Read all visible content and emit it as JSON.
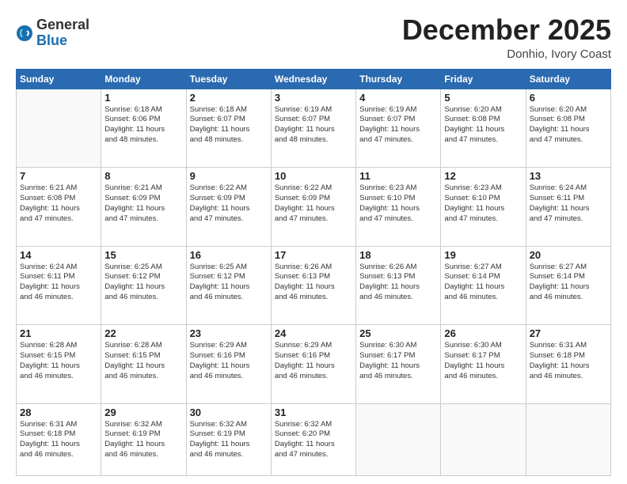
{
  "header": {
    "logo_general": "General",
    "logo_blue": "Blue",
    "month": "December 2025",
    "location": "Donhio, Ivory Coast"
  },
  "weekdays": [
    "Sunday",
    "Monday",
    "Tuesday",
    "Wednesday",
    "Thursday",
    "Friday",
    "Saturday"
  ],
  "weeks": [
    [
      {
        "day": "",
        "info": ""
      },
      {
        "day": "1",
        "info": "Sunrise: 6:18 AM\nSunset: 6:06 PM\nDaylight: 11 hours\nand 48 minutes."
      },
      {
        "day": "2",
        "info": "Sunrise: 6:18 AM\nSunset: 6:07 PM\nDaylight: 11 hours\nand 48 minutes."
      },
      {
        "day": "3",
        "info": "Sunrise: 6:19 AM\nSunset: 6:07 PM\nDaylight: 11 hours\nand 48 minutes."
      },
      {
        "day": "4",
        "info": "Sunrise: 6:19 AM\nSunset: 6:07 PM\nDaylight: 11 hours\nand 47 minutes."
      },
      {
        "day": "5",
        "info": "Sunrise: 6:20 AM\nSunset: 6:08 PM\nDaylight: 11 hours\nand 47 minutes."
      },
      {
        "day": "6",
        "info": "Sunrise: 6:20 AM\nSunset: 6:08 PM\nDaylight: 11 hours\nand 47 minutes."
      }
    ],
    [
      {
        "day": "7",
        "info": "Sunrise: 6:21 AM\nSunset: 6:08 PM\nDaylight: 11 hours\nand 47 minutes."
      },
      {
        "day": "8",
        "info": "Sunrise: 6:21 AM\nSunset: 6:09 PM\nDaylight: 11 hours\nand 47 minutes."
      },
      {
        "day": "9",
        "info": "Sunrise: 6:22 AM\nSunset: 6:09 PM\nDaylight: 11 hours\nand 47 minutes."
      },
      {
        "day": "10",
        "info": "Sunrise: 6:22 AM\nSunset: 6:09 PM\nDaylight: 11 hours\nand 47 minutes."
      },
      {
        "day": "11",
        "info": "Sunrise: 6:23 AM\nSunset: 6:10 PM\nDaylight: 11 hours\nand 47 minutes."
      },
      {
        "day": "12",
        "info": "Sunrise: 6:23 AM\nSunset: 6:10 PM\nDaylight: 11 hours\nand 47 minutes."
      },
      {
        "day": "13",
        "info": "Sunrise: 6:24 AM\nSunset: 6:11 PM\nDaylight: 11 hours\nand 47 minutes."
      }
    ],
    [
      {
        "day": "14",
        "info": "Sunrise: 6:24 AM\nSunset: 6:11 PM\nDaylight: 11 hours\nand 46 minutes."
      },
      {
        "day": "15",
        "info": "Sunrise: 6:25 AM\nSunset: 6:12 PM\nDaylight: 11 hours\nand 46 minutes."
      },
      {
        "day": "16",
        "info": "Sunrise: 6:25 AM\nSunset: 6:12 PM\nDaylight: 11 hours\nand 46 minutes."
      },
      {
        "day": "17",
        "info": "Sunrise: 6:26 AM\nSunset: 6:13 PM\nDaylight: 11 hours\nand 46 minutes."
      },
      {
        "day": "18",
        "info": "Sunrise: 6:26 AM\nSunset: 6:13 PM\nDaylight: 11 hours\nand 46 minutes."
      },
      {
        "day": "19",
        "info": "Sunrise: 6:27 AM\nSunset: 6:14 PM\nDaylight: 11 hours\nand 46 minutes."
      },
      {
        "day": "20",
        "info": "Sunrise: 6:27 AM\nSunset: 6:14 PM\nDaylight: 11 hours\nand 46 minutes."
      }
    ],
    [
      {
        "day": "21",
        "info": "Sunrise: 6:28 AM\nSunset: 6:15 PM\nDaylight: 11 hours\nand 46 minutes."
      },
      {
        "day": "22",
        "info": "Sunrise: 6:28 AM\nSunset: 6:15 PM\nDaylight: 11 hours\nand 46 minutes."
      },
      {
        "day": "23",
        "info": "Sunrise: 6:29 AM\nSunset: 6:16 PM\nDaylight: 11 hours\nand 46 minutes."
      },
      {
        "day": "24",
        "info": "Sunrise: 6:29 AM\nSunset: 6:16 PM\nDaylight: 11 hours\nand 46 minutes."
      },
      {
        "day": "25",
        "info": "Sunrise: 6:30 AM\nSunset: 6:17 PM\nDaylight: 11 hours\nand 46 minutes."
      },
      {
        "day": "26",
        "info": "Sunrise: 6:30 AM\nSunset: 6:17 PM\nDaylight: 11 hours\nand 46 minutes."
      },
      {
        "day": "27",
        "info": "Sunrise: 6:31 AM\nSunset: 6:18 PM\nDaylight: 11 hours\nand 46 minutes."
      }
    ],
    [
      {
        "day": "28",
        "info": "Sunrise: 6:31 AM\nSunset: 6:18 PM\nDaylight: 11 hours\nand 46 minutes."
      },
      {
        "day": "29",
        "info": "Sunrise: 6:32 AM\nSunset: 6:19 PM\nDaylight: 11 hours\nand 46 minutes."
      },
      {
        "day": "30",
        "info": "Sunrise: 6:32 AM\nSunset: 6:19 PM\nDaylight: 11 hours\nand 46 minutes."
      },
      {
        "day": "31",
        "info": "Sunrise: 6:32 AM\nSunset: 6:20 PM\nDaylight: 11 hours\nand 47 minutes."
      },
      {
        "day": "",
        "info": ""
      },
      {
        "day": "",
        "info": ""
      },
      {
        "day": "",
        "info": ""
      }
    ]
  ]
}
